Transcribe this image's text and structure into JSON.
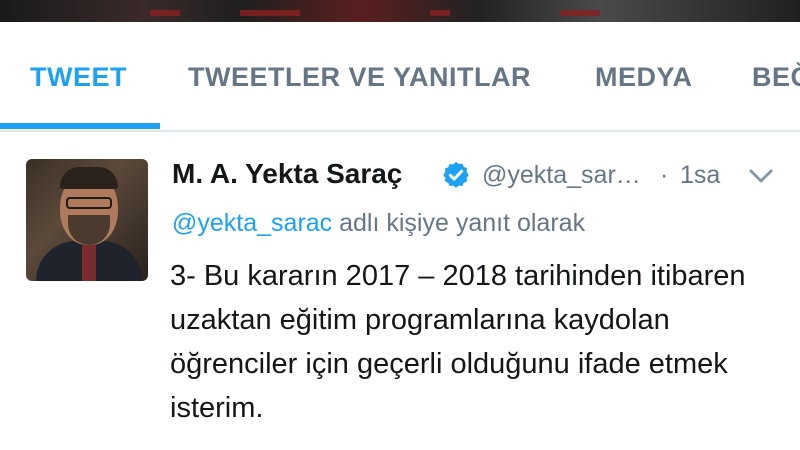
{
  "tabs": [
    {
      "label": "TWEET"
    },
    {
      "label": "TWEETLER VE YANITLAR"
    },
    {
      "label": "MEDYA"
    },
    {
      "label": "BEĞ"
    }
  ],
  "active_tab": "TWEET",
  "colors": {
    "accent": "#1da1f2",
    "muted": "#657786",
    "text": "#14171a"
  },
  "tweet": {
    "author_name": "M. A. Yekta Saraç",
    "handle": "@yekta_sar…",
    "separator": "·",
    "time": "1sa",
    "reply_mention": "@yekta_sarac",
    "reply_suffix": " adlı kişiye yanıt olarak",
    "text": "3- Bu kararın 2017 – 2018 tarihinden itibaren uzaktan eğitim programlarına kaydolan öğrenciler için geçerli olduğunu ifade etmek isterim.",
    "verified": true,
    "icons": {
      "verified": "verified-badge-icon",
      "menu": "chevron-down-icon"
    }
  }
}
